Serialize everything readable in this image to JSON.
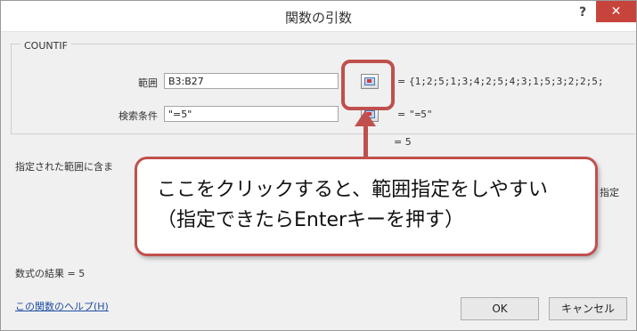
{
  "dialog": {
    "title": "関数の引数",
    "help_button": "?",
    "close_button": "✕"
  },
  "function": {
    "name": "COUNTIF",
    "args": [
      {
        "label": "範囲",
        "value": "B3:B27",
        "result": "{1;2;5;1;3;4;2;5;4;3;1;5;3;2;2;5;"
      },
      {
        "label": "検索条件",
        "value": "\"=5\"",
        "result": "\"=5\""
      }
    ],
    "equals": "=",
    "overall_result": "= 5",
    "description": "指定された範囲に含ま",
    "description_tail": "指定"
  },
  "footer": {
    "formula_result": "数式の結果 = 5",
    "help_link": "この関数のヘルプ(H)",
    "ok_label": "OK",
    "cancel_label": "キャンセル"
  },
  "annotation": {
    "line1": "ここをクリックすると、範囲指定をしやすい",
    "line2": "（指定できたらEnterキーを押す）",
    "color": "#c0504d"
  }
}
